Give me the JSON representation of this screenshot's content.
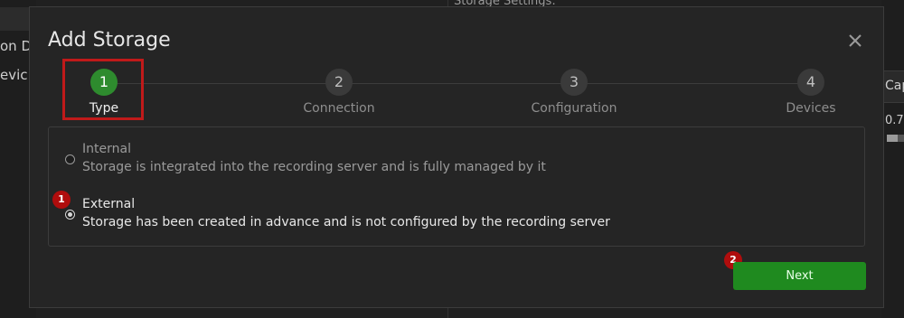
{
  "background": {
    "left_text_1": "on D",
    "left_text_2": "evic",
    "top_text": "Storage Settings:",
    "right_header": "Cap",
    "right_value": "0.7"
  },
  "dialog": {
    "title": "Add Storage",
    "close_icon": "close-icon",
    "steps": [
      {
        "number": "1",
        "label": "Type",
        "active": true
      },
      {
        "number": "2",
        "label": "Connection",
        "active": false
      },
      {
        "number": "3",
        "label": "Configuration",
        "active": false
      },
      {
        "number": "4",
        "label": "Devices",
        "active": false
      }
    ],
    "options": [
      {
        "title": "Internal",
        "description": "Storage is integrated into the recording server and is fully managed by it",
        "selected": false
      },
      {
        "title": "External",
        "description": "Storage has been created in advance and is not configured by the recording server",
        "selected": true
      }
    ],
    "badges": [
      "1",
      "2"
    ],
    "next_label": "Next"
  },
  "colors": {
    "accent_green": "#2e8b2e",
    "button_green": "#1f8a1f",
    "highlight_red": "#c01a1a",
    "badge_red": "#b00d0d"
  }
}
